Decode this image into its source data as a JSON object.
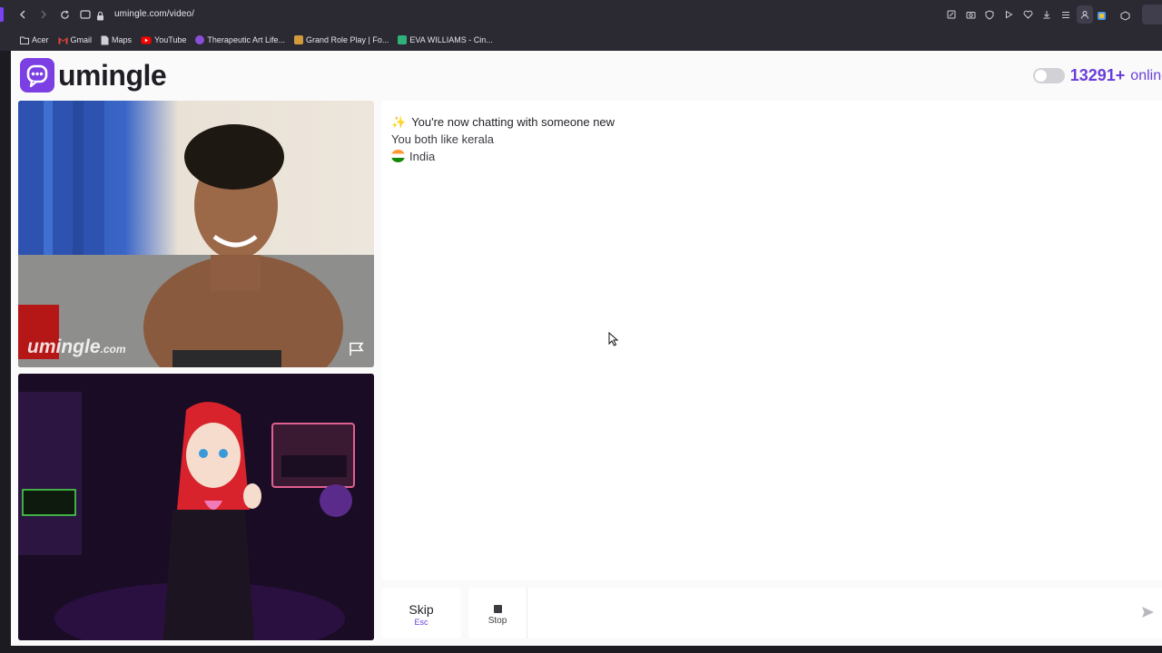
{
  "browser": {
    "url": "umingle.com/video/",
    "bookmarks": [
      {
        "label": "Acer",
        "icon": "folder-icon",
        "color": "#cfcfd8"
      },
      {
        "label": "Gmail",
        "icon": "gmail-icon",
        "color": "#ea4335"
      },
      {
        "label": "Maps",
        "icon": "document-icon",
        "color": "#cfcfd8"
      },
      {
        "label": "YouTube",
        "icon": "youtube-icon",
        "color": "#ff0000"
      },
      {
        "label": "Therapeutic Art Life...",
        "icon": "site-icon",
        "color": "#8a4fd8"
      },
      {
        "label": "Grand Role Play | Fo...",
        "icon": "site-icon",
        "color": "#d29a3a"
      },
      {
        "label": "EVA WILLIAMS - Cin...",
        "icon": "site-icon",
        "color": "#2fb27a"
      }
    ]
  },
  "header": {
    "logo_text": "umingle",
    "online_count": "13291+",
    "online_word": "online"
  },
  "video": {
    "remote_watermark": "umingle",
    "remote_watermark_suffix": ".com"
  },
  "chat": {
    "headline": "You're now chatting with someone new",
    "interest": "You both like kerala",
    "country": "India"
  },
  "controls": {
    "skip_label": "Skip",
    "skip_key": "Esc",
    "stop_label": "Stop"
  },
  "colors": {
    "brand": "#7b3fe4",
    "accent_text": "#6a3fd8"
  }
}
